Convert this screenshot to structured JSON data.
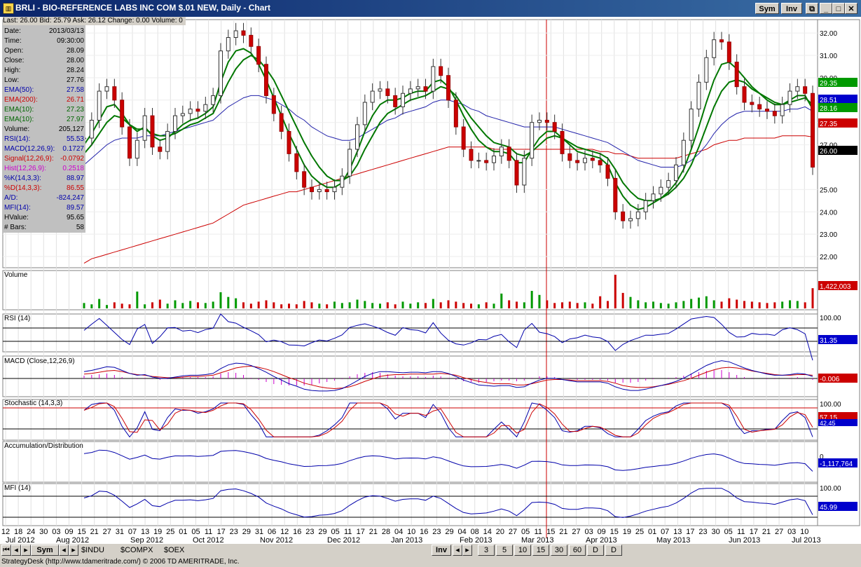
{
  "window": {
    "title": "BRLI - BIO-REFERENCE LABS INC COM $.01 NEW, Daily - Chart",
    "sym_button": "Sym",
    "inv_button": "Inv"
  },
  "quote_bar": "Last: 26.00  Bid: 25.79  Ask: 26.12  Change: 0.00  Volume: 0",
  "data_box": [
    {
      "label": "Date:",
      "value": "2013/03/13",
      "color": "#000000"
    },
    {
      "label": "Time:",
      "value": "09:30:00",
      "color": "#000000"
    },
    {
      "label": "Open:",
      "value": "28.09",
      "color": "#000000"
    },
    {
      "label": "Close:",
      "value": "28.00",
      "color": "#000000"
    },
    {
      "label": "High:",
      "value": "28.24",
      "color": "#000000"
    },
    {
      "label": "Low:",
      "value": "27.76",
      "color": "#000000"
    },
    {
      "label": "EMA(50):",
      "value": "27.58",
      "color": "#0000aa"
    },
    {
      "label": "EMA(200):",
      "value": "26.71",
      "color": "#cc0000"
    },
    {
      "label": "EMA(10):",
      "value": "27.23",
      "color": "#006600"
    },
    {
      "label": "EMA(10):",
      "value": "27.97",
      "color": "#006600"
    },
    {
      "label": "Volume:",
      "value": "205,127",
      "color": "#000000"
    },
    {
      "label": "RSI(14):",
      "value": "55.53",
      "color": "#0000aa"
    },
    {
      "label": "MACD(12,26,9):",
      "value": "0.1727",
      "color": "#0000aa"
    },
    {
      "label": "Signal(12,26,9):",
      "value": "-0.0792",
      "color": "#cc0000"
    },
    {
      "label": "Hist(12,26,9):",
      "value": "0.2518",
      "color": "#cc00cc"
    },
    {
      "label": "%K(14,3,3):",
      "value": "88.97",
      "color": "#0000aa"
    },
    {
      "label": "%D(14,3,3):",
      "value": "86.55",
      "color": "#cc0000"
    },
    {
      "label": "A/D:",
      "value": "-824,247",
      "color": "#0000aa"
    },
    {
      "label": "MFI(14):",
      "value": "89.57",
      "color": "#0000aa"
    },
    {
      "label": "HValue:",
      "value": "95.65",
      "color": "#000000"
    },
    {
      "label": "# Bars:",
      "value": "58",
      "color": "#000000"
    }
  ],
  "price_axis": [
    "32.00",
    "31.00",
    "30.00",
    "29.00",
    "28.00",
    "27.00",
    "25.00",
    "24.00",
    "23.00",
    "22.00"
  ],
  "price_markers": [
    {
      "value": "29.35",
      "color": "#009900"
    },
    {
      "value": "28.51",
      "color": "#0000cc"
    },
    {
      "value": "28.16",
      "color": "#009900"
    },
    {
      "value": "27.35",
      "color": "#cc0000"
    },
    {
      "value": "26.00",
      "color": "#000000"
    }
  ],
  "panels": {
    "volume": {
      "title": "Volume",
      "marker": "1,422,003"
    },
    "rsi": {
      "title": "RSI (14)",
      "top": "100.00",
      "marker": "31.35"
    },
    "macd": {
      "title": "MACD (Close,12,26,9)",
      "marker": "-0.006"
    },
    "stochastic": {
      "title": "Stochastic (14,3,3)",
      "top": "100.00",
      "marker": "57.15",
      "marker2": "42.45"
    },
    "ad": {
      "title": "Accumulation/Distribution",
      "top": "0",
      "marker": "-1,117,764"
    },
    "mfi": {
      "title": "MFI (14)",
      "top": "100.00",
      "marker": "45.99"
    }
  },
  "x_days": [
    "12",
    "18",
    "24",
    "30",
    "03",
    "09",
    "15",
    "21",
    "27",
    "31",
    "07",
    "13",
    "19",
    "25",
    "01",
    "05",
    "11",
    "17",
    "23",
    "29",
    "31",
    "06",
    "12",
    "16",
    "23",
    "29",
    "05",
    "11",
    "17",
    "21",
    "28",
    "04",
    "10",
    "16",
    "23",
    "29",
    "04",
    "08",
    "14",
    "20",
    "27",
    "05",
    "11",
    "15",
    "21",
    "27",
    "03",
    "09",
    "15",
    "19",
    "25",
    "01",
    "07",
    "13",
    "17",
    "23",
    "30",
    "05",
    "11",
    "17",
    "21",
    "27",
    "03",
    "10"
  ],
  "x_months": [
    "Jul 2012",
    "Aug 2012",
    "Sep 2012",
    "Oct 2012",
    "Nov 2012",
    "Dec 2012",
    "Jan 2013",
    "Feb 2013",
    "Mar 2013",
    "Apr 2013",
    "May 2013",
    "Jun 2013",
    "Jul 2013"
  ],
  "tabs": [
    "$INDU",
    "$COMPX",
    "$OEX"
  ],
  "bottom_sym": "Sym",
  "bottom_inv": "Inv",
  "periods": [
    "3",
    "5",
    "10",
    "15",
    "30",
    "60",
    "D",
    "D"
  ],
  "status": "StrategyDesk (http://www.tdameritrade.com/) © 2006 TD AMERITRADE, Inc.",
  "chart_data": {
    "type": "line",
    "title": "BRLI - BIO-REFERENCE LABS INC COM $.01 NEW, Daily - Chart",
    "xlabel": "",
    "ylabel": "",
    "ylim": [
      21.5,
      32.6
    ],
    "close": [
      27.3,
      28.1,
      29.4,
      29.6,
      29.0,
      27.8,
      26.4,
      27.2,
      28.3,
      26.9,
      26.7,
      27.6,
      28.3,
      28.4,
      28.6,
      28.5,
      28.8,
      29.2,
      31.2,
      31.8,
      32.1,
      31.9,
      31.4,
      30.6,
      29.2,
      28.4,
      27.6,
      26.6,
      25.8,
      25.1,
      24.9,
      25.0,
      24.9,
      25.1,
      25.6,
      26.8,
      27.9,
      28.9,
      29.4,
      29.5,
      29.2,
      28.7,
      29.3,
      29.5,
      29.6,
      29.4,
      30.5,
      30.1,
      29.0,
      27.8,
      26.8,
      26.3,
      26.3,
      26.2,
      26.5,
      26.9,
      26.3,
      25.2,
      26.4,
      28.0,
      28.1,
      28.0,
      27.6,
      26.6,
      26.3,
      26.2,
      26.4,
      26.3,
      26.1,
      25.5,
      24.0,
      23.6,
      23.7,
      24.0,
      24.5,
      24.8,
      25.1,
      25.4,
      26.1,
      27.2,
      28.6,
      29.8,
      30.9,
      31.7,
      31.6,
      30.7,
      29.6,
      28.9,
      28.8,
      28.6,
      28.5,
      28.3,
      28.8,
      29.4,
      29.6,
      29.3,
      26.0
    ],
    "ema10_fast": [
      27.0,
      27.5,
      28.1,
      28.7,
      28.8,
      28.4,
      27.9,
      27.6,
      27.8,
      27.4,
      27.2,
      27.3,
      27.6,
      27.9,
      28.1,
      28.2,
      28.4,
      28.7,
      29.8,
      30.7,
      31.2,
      31.3,
      31.1,
      30.6,
      29.9,
      29.1,
      28.3,
      27.5,
      26.8,
      26.1,
      25.6,
      25.3,
      25.1,
      25.1,
      25.3,
      25.9,
      26.7,
      27.6,
      28.3,
      28.8,
      29.0,
      29.0,
      29.1,
      29.3,
      29.4,
      29.4,
      29.8,
      29.9,
      29.6,
      29.0,
      28.3,
      27.7,
      27.2,
      26.9,
      26.7,
      26.7,
      26.6,
      26.2,
      26.2,
      26.8,
      27.3,
      27.6,
      27.6,
      27.3,
      27.0,
      26.7,
      26.6,
      26.5,
      26.4,
      26.1,
      25.3,
      24.7,
      24.3,
      24.1,
      24.2,
      24.4,
      24.6,
      24.9,
      25.3,
      25.9,
      26.8,
      27.8,
      28.9,
      29.9,
      30.6,
      30.7,
      30.4,
      30.0,
      29.6,
      29.3,
      29.0,
      28.8,
      28.8,
      29.0,
      29.2,
      29.2,
      28.6
    ],
    "ema10_slow": [
      26.6,
      27.0,
      27.5,
      28.0,
      28.3,
      28.2,
      27.9,
      27.7,
      27.7,
      27.5,
      27.4,
      27.4,
      27.5,
      27.7,
      27.9,
      28.0,
      28.2,
      28.4,
      29.1,
      29.8,
      30.4,
      30.8,
      31.0,
      30.8,
      30.4,
      29.9,
      29.2,
      28.5,
      27.8,
      27.1,
      26.5,
      26.0,
      25.6,
      25.4,
      25.4,
      25.6,
      26.1,
      26.8,
      27.4,
      28.0,
      28.4,
      28.6,
      28.8,
      29.0,
      29.1,
      29.2,
      29.4,
      29.6,
      29.5,
      29.2,
      28.7,
      28.2,
      27.8,
      27.4,
      27.1,
      27.0,
      26.9,
      26.6,
      26.5,
      26.7,
      27.0,
      27.3,
      27.4,
      27.3,
      27.1,
      26.9,
      26.8,
      26.7,
      26.6,
      26.4,
      25.9,
      25.3,
      24.9,
      24.6,
      24.5,
      24.5,
      24.6,
      24.8,
      25.1,
      25.5,
      26.1,
      26.9,
      27.8,
      28.7,
      29.4,
      29.8,
      29.9,
      29.8,
      29.5,
      29.3,
      29.1,
      28.9,
      28.8,
      28.9,
      29.0,
      29.1,
      28.8
    ],
    "ema50": [
      26.1,
      26.4,
      26.7,
      27.0,
      27.2,
      27.3,
      27.3,
      27.3,
      27.4,
      27.4,
      27.4,
      27.5,
      27.6,
      27.7,
      27.8,
      27.9,
      28.0,
      28.1,
      28.4,
      28.7,
      28.9,
      29.1,
      29.2,
      29.2,
      29.1,
      29.0,
      28.8,
      28.6,
      28.3,
      28.1,
      27.8,
      27.6,
      27.4,
      27.3,
      27.2,
      27.2,
      27.3,
      27.5,
      27.7,
      27.9,
      28.1,
      28.2,
      28.4,
      28.5,
      28.6,
      28.7,
      28.9,
      29.0,
      29.0,
      28.9,
      28.8,
      28.6,
      28.5,
      28.3,
      28.2,
      28.1,
      28.0,
      27.9,
      27.8,
      27.8,
      27.8,
      27.8,
      27.8,
      27.7,
      27.6,
      27.5,
      27.4,
      27.3,
      27.2,
      27.1,
      26.9,
      26.7,
      26.5,
      26.3,
      26.2,
      26.1,
      26.0,
      26.0,
      26.0,
      26.1,
      26.3,
      26.6,
      27.0,
      27.5,
      27.9,
      28.2,
      28.4,
      28.5,
      28.5,
      28.5,
      28.5,
      28.5,
      28.5,
      28.6,
      28.6,
      28.7,
      28.5
    ],
    "ema200": [
      21.7,
      21.9,
      22.0,
      22.1,
      22.2,
      22.3,
      22.4,
      22.5,
      22.6,
      22.7,
      22.8,
      22.9,
      23.0,
      23.1,
      23.2,
      23.3,
      23.4,
      23.5,
      23.7,
      23.9,
      24.1,
      24.3,
      24.4,
      24.5,
      24.6,
      24.7,
      24.8,
      24.9,
      24.9,
      25.0,
      25.1,
      25.2,
      25.3,
      25.4,
      25.5,
      25.6,
      25.7,
      25.8,
      25.9,
      26.0,
      26.1,
      26.2,
      26.3,
      26.4,
      26.5,
      26.6,
      26.7,
      26.8,
      26.9,
      26.9,
      26.9,
      26.9,
      26.9,
      26.9,
      26.8,
      26.8,
      26.8,
      26.8,
      26.8,
      26.8,
      26.8,
      26.8,
      26.8,
      26.8,
      26.8,
      26.8,
      26.8,
      26.8,
      26.7,
      26.7,
      26.6,
      26.6,
      26.5,
      26.4,
      26.4,
      26.4,
      26.4,
      26.4,
      26.4,
      26.5,
      26.6,
      26.7,
      26.8,
      27.0,
      27.1,
      27.2,
      27.2,
      27.3,
      27.3,
      27.3,
      27.3,
      27.3,
      27.4,
      27.4,
      27.4,
      27.4,
      27.35
    ],
    "volume": [
      80,
      60,
      140,
      50,
      90,
      70,
      60,
      250,
      60,
      90,
      130,
      70,
      120,
      80,
      110,
      90,
      80,
      100,
      240,
      170,
      150,
      90,
      70,
      100,
      120,
      90,
      60,
      70,
      60,
      110,
      90,
      70,
      60,
      100,
      80,
      90,
      130,
      110,
      80,
      70,
      90,
      60,
      100,
      70,
      90,
      80,
      140,
      90,
      120,
      100,
      80,
      70,
      60,
      90,
      70,
      220,
      120,
      100,
      90,
      260,
      200,
      120,
      80,
      90,
      100,
      80,
      90,
      70,
      180,
      110,
      500,
      230,
      170,
      120,
      90,
      100,
      80,
      70,
      90,
      110,
      140,
      160,
      180,
      120,
      100,
      150,
      130,
      110,
      100,
      90,
      80,
      90,
      100,
      120,
      110,
      90,
      300
    ]
  }
}
